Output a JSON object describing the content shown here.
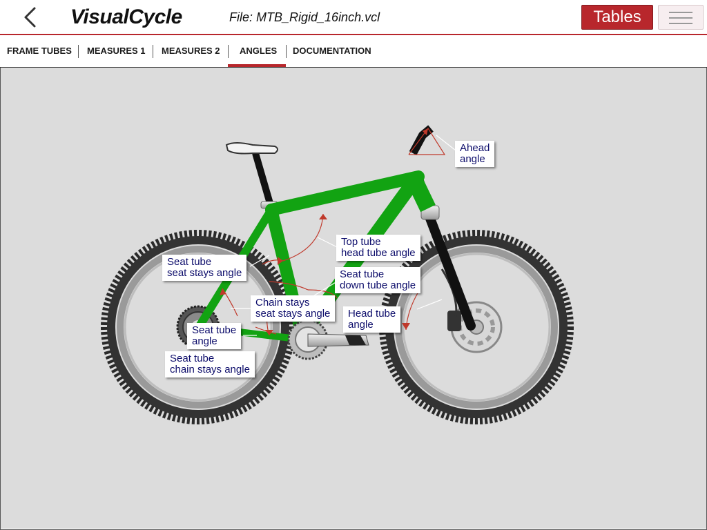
{
  "header": {
    "app_title": "VisualCycle",
    "file_label": "File: MTB_Rigid_16inch.vcl",
    "tables_button": "Tables"
  },
  "tabs": [
    {
      "label": "FRAME TUBES",
      "active": false
    },
    {
      "label": "MEASURES 1",
      "active": false
    },
    {
      "label": "MEASURES 2",
      "active": false
    },
    {
      "label": "ANGLES",
      "active": true
    },
    {
      "label": "DOCUMENTATION",
      "active": false
    }
  ],
  "angles": {
    "ahead": "Ahead\nangle",
    "top_head": "Top tube\nhead tube angle",
    "seat_stays": "Seat tube\nseat stays angle",
    "seat_down": "Seat tube\ndown tube angle",
    "chain_seat_stays": "Chain stays\nseat stays angle",
    "head_tube": "Head tube\nangle",
    "seat_tube": "Seat tube\nangle",
    "seat_chain": "Seat tube\nchain stays angle"
  },
  "colors": {
    "accent": "#b8272c",
    "frame": "#12a312",
    "callout_text": "#0d0d6b",
    "canvas_bg": "#dcdcdc"
  },
  "icons": {
    "back": "chevron-left-icon",
    "menu": "hamburger-menu-icon"
  }
}
